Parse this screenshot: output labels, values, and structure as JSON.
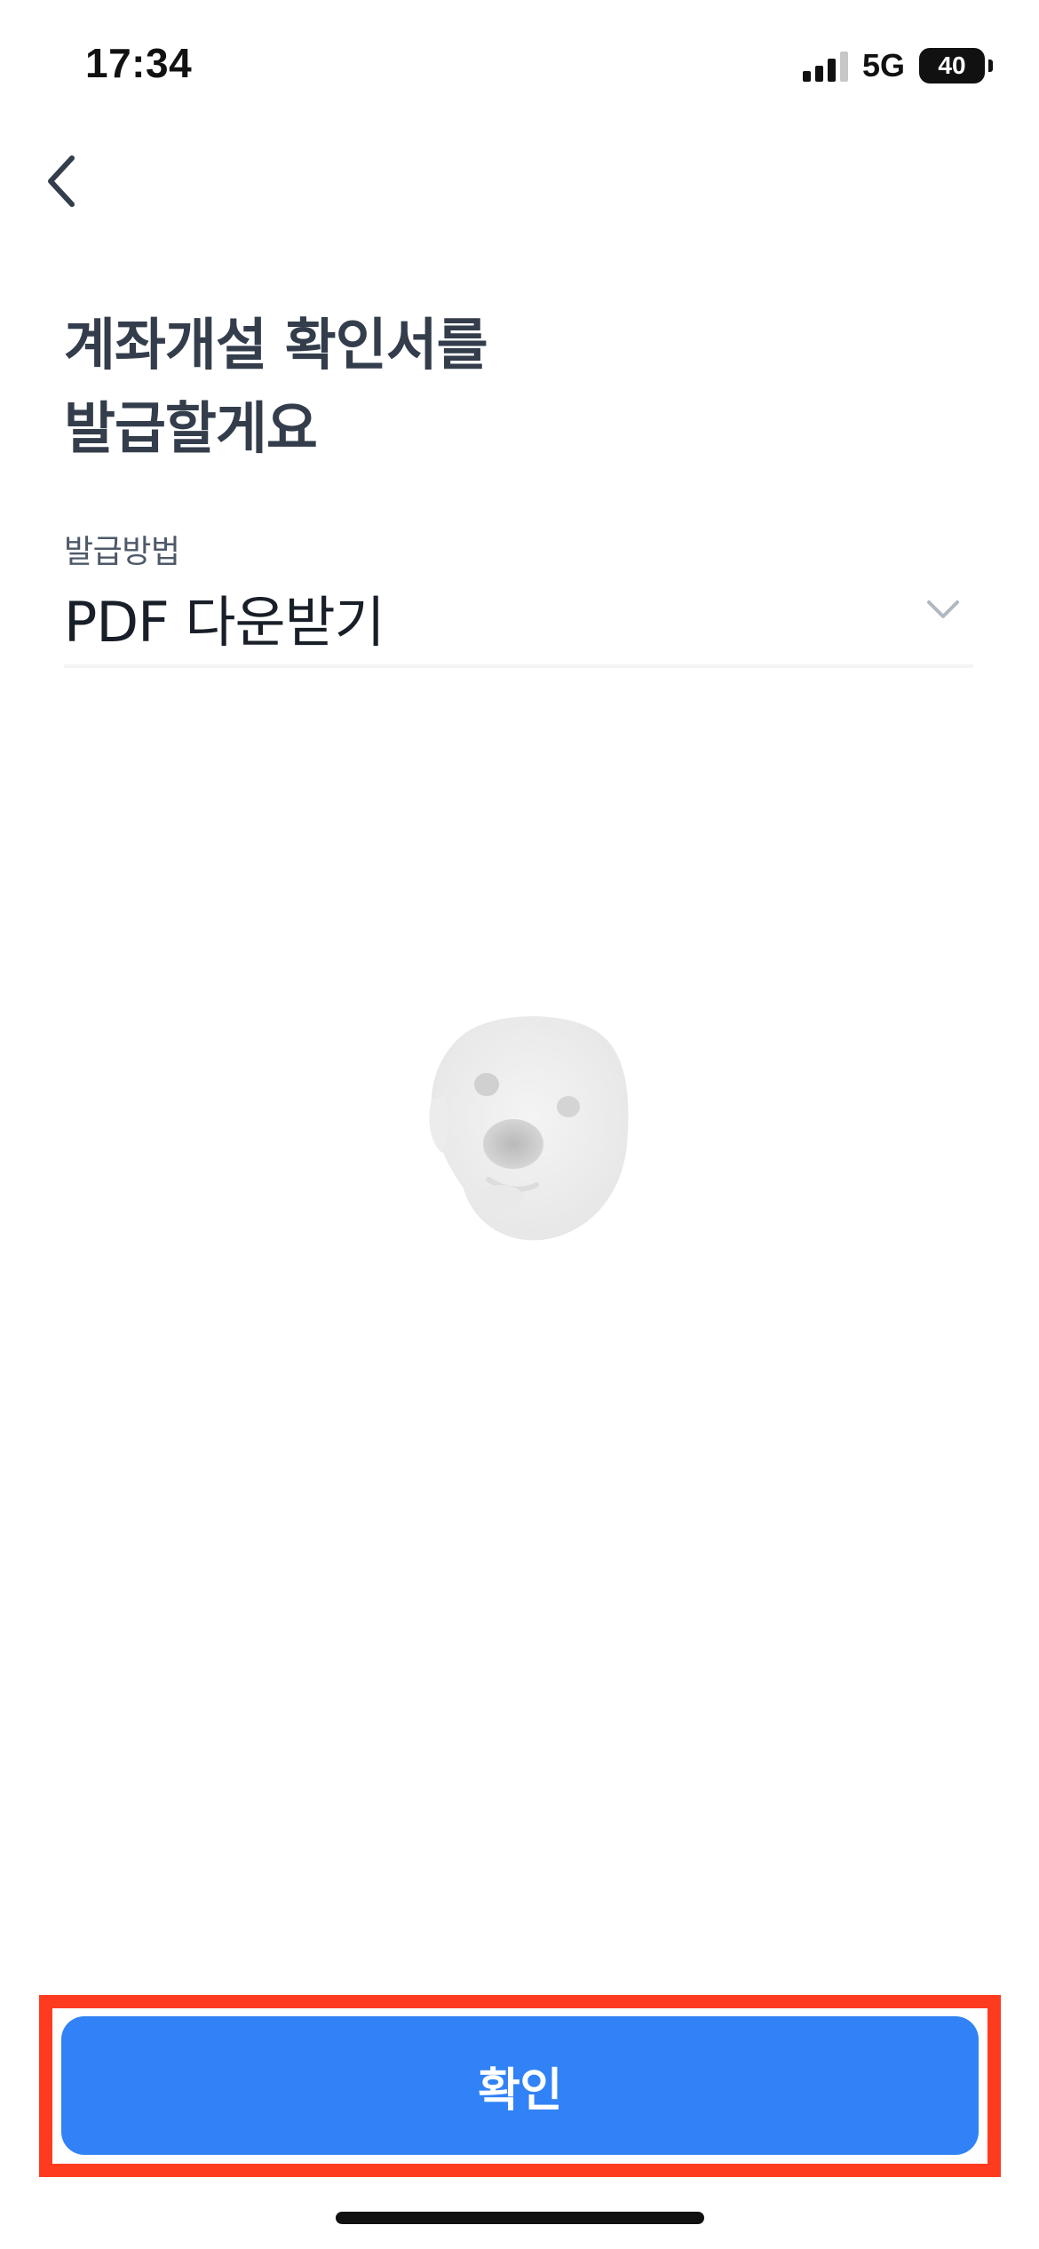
{
  "status_bar": {
    "time": "17:34",
    "network": "5G",
    "battery": "40"
  },
  "header": {
    "back_icon": "chevron-left-icon"
  },
  "title": {
    "line1": "계좌개설 확인서를",
    "line2": "발급할게요"
  },
  "issue_method": {
    "label": "발급방법",
    "value": "PDF 다운받기",
    "icon": "chevron-down-icon"
  },
  "illustration": {
    "icon": "dog-face-icon"
  },
  "footer": {
    "confirm_label": "확인",
    "button_color": "#3182f6",
    "highlight_color": "#ff3b1f"
  }
}
